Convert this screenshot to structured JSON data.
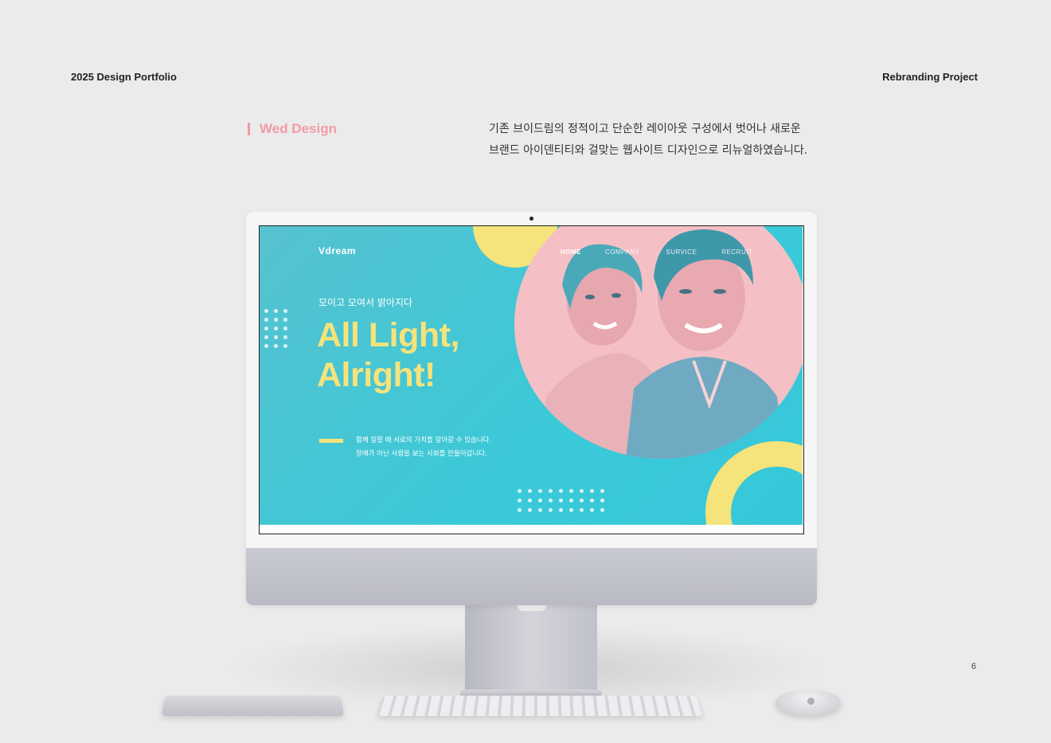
{
  "header": {
    "left": "2025 Design Portfolio",
    "right": "Rebranding Project"
  },
  "section": {
    "title": "Wed Design",
    "description_line1": "기존 브이드림의 정적이고 단순한 레이아웃 구성에서 벗어나 새로운",
    "description_line2": "브랜드 아이덴티티와 걸맞는 웹사이트 디자인으로 리뉴얼하였습니다."
  },
  "site": {
    "logo": "Vdream",
    "nav": [
      "HOME",
      "COMPANY",
      "SURVICE",
      "RECRUIT"
    ],
    "subtitle": "모이고 모여서 밝아지다",
    "hero_line1": "All Light,",
    "hero_line2": "Alright!",
    "body_line1": "함께 일할 때 서로의 가치를 알아갈 수 있습니다.",
    "body_line2": "장애가 아닌 사람을 보는 사회를 만들어갑니다.",
    "colors": {
      "background": "#3ac9d8",
      "accent_yellow": "#f5e37b",
      "accent_pink": "#f4c0c5"
    }
  },
  "footer": {
    "page_number": "6"
  }
}
